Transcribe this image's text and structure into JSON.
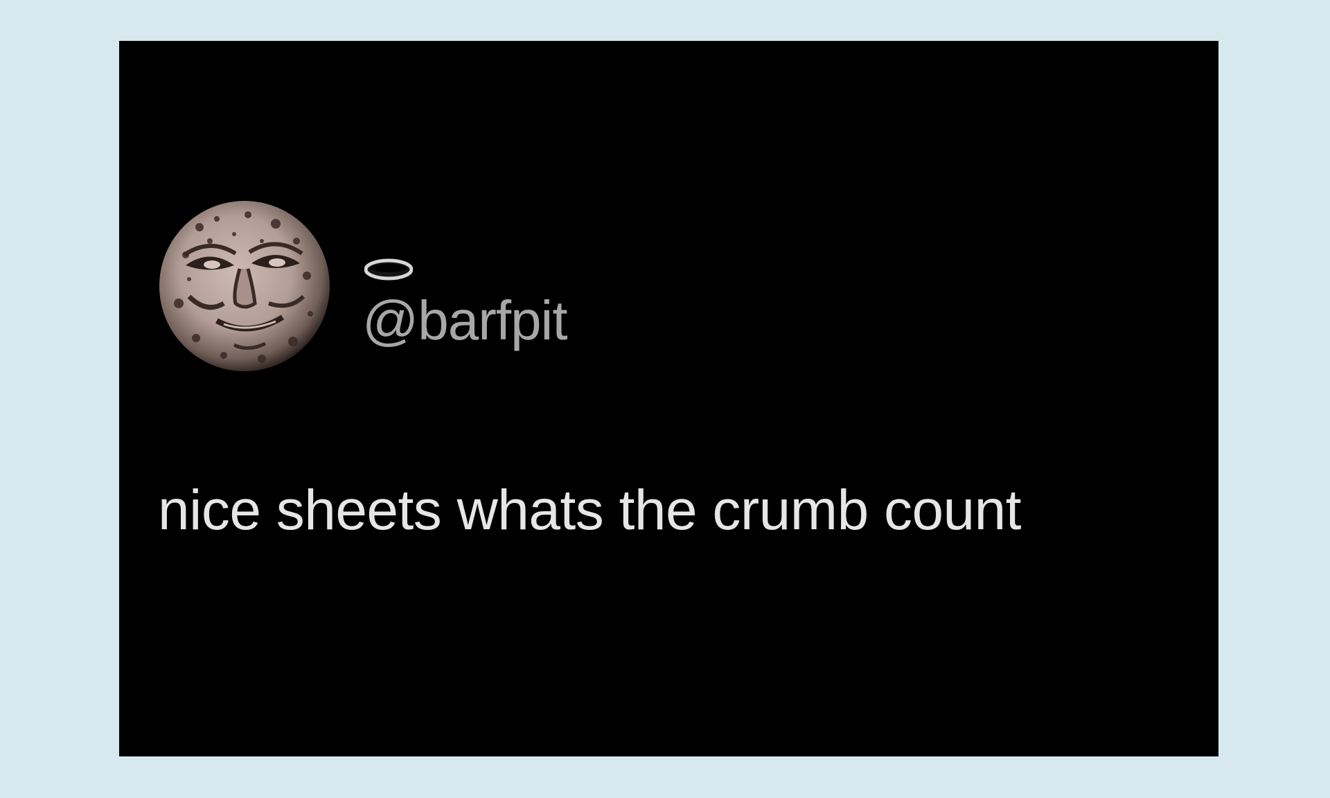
{
  "colors": {
    "page_background": "#d7e9ef",
    "card_background": "#000000",
    "handle_text": "#a7a7a7",
    "tweet_text": "#e6e6e6",
    "moon_light": "#c2aea6",
    "moon_dark": "#3a2a26",
    "halo": "#d8d8d8"
  },
  "tweet": {
    "avatar_icon": "moon-face-icon",
    "halo_icon": "halo-icon",
    "handle": "@barfpit",
    "text": "nice sheets  whats the crumb count"
  }
}
